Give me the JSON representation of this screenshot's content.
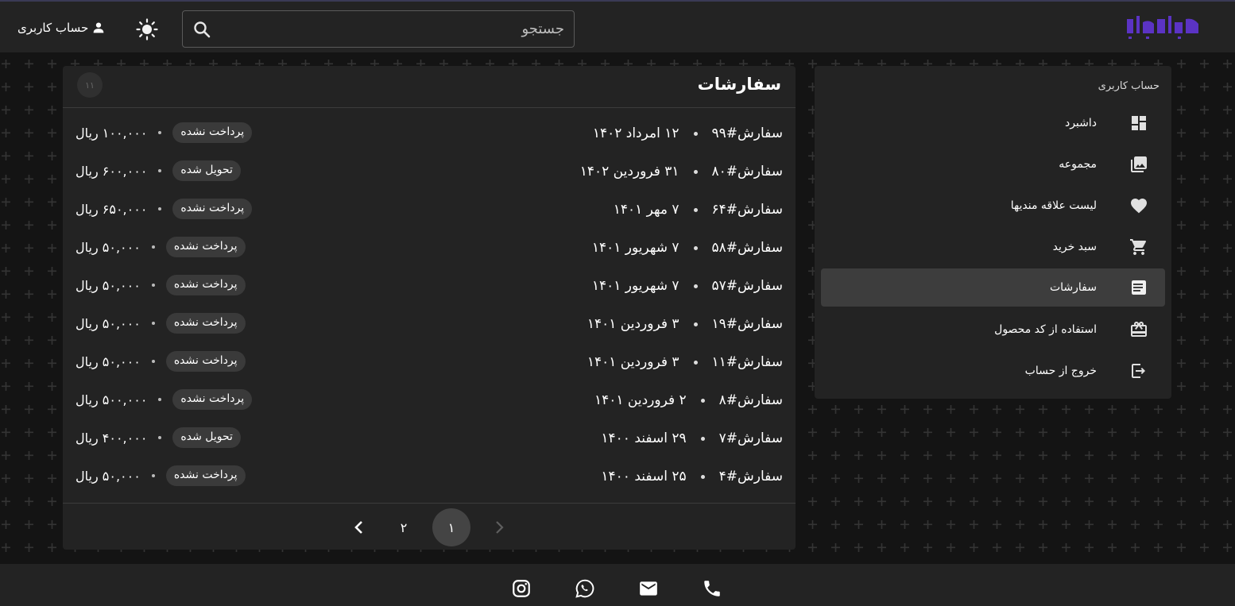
{
  "header": {
    "search_placeholder": "جستجو",
    "account_label": "حساب کاربری"
  },
  "sidebar": {
    "title": "حساب کاربری",
    "items": [
      {
        "label": "داشبرد",
        "icon": "dashboard-icon"
      },
      {
        "label": "مجموعه",
        "icon": "collection-icon"
      },
      {
        "label": "لیست علاقه مندیها",
        "icon": "heart-icon"
      },
      {
        "label": "سبد خرید",
        "icon": "cart-icon"
      },
      {
        "label": "سفارشات",
        "icon": "orders-list-icon",
        "active": true
      },
      {
        "label": "استفاده از کد محصول",
        "icon": "gift-icon"
      },
      {
        "label": "خروج از حساب",
        "icon": "logout-icon"
      }
    ]
  },
  "orders": {
    "title": "سفارشات",
    "count": "۱۱",
    "rows": [
      {
        "id": "سفارش#۹۹",
        "date": "۱۲ امرداد ۱۴۰۲",
        "status": "پرداخت نشده",
        "amount": "۱۰۰,۰۰۰ ریال"
      },
      {
        "id": "سفارش#۸۰",
        "date": "۳۱ فروردین ۱۴۰۲",
        "status": "تحویل شده",
        "amount": "۶۰۰,۰۰۰ ریال"
      },
      {
        "id": "سفارش#۶۴",
        "date": "۷ مهر ۱۴۰۱",
        "status": "پرداخت نشده",
        "amount": "۶۵۰,۰۰۰ ریال"
      },
      {
        "id": "سفارش#۵۸",
        "date": "۷ شهریور ۱۴۰۱",
        "status": "پرداخت نشده",
        "amount": "۵۰,۰۰۰ ریال"
      },
      {
        "id": "سفارش#۵۷",
        "date": "۷ شهریور ۱۴۰۱",
        "status": "پرداخت نشده",
        "amount": "۵۰,۰۰۰ ریال"
      },
      {
        "id": "سفارش#۱۹",
        "date": "۳ فروردین ۱۴۰۱",
        "status": "پرداخت نشده",
        "amount": "۵۰,۰۰۰ ریال"
      },
      {
        "id": "سفارش#۱۱",
        "date": "۳ فروردین ۱۴۰۱",
        "status": "پرداخت نشده",
        "amount": "۵۰,۰۰۰ ریال"
      },
      {
        "id": "سفارش#۸",
        "date": "۲ فروردین ۱۴۰۱",
        "status": "پرداخت نشده",
        "amount": "۵۰۰,۰۰۰ ریال"
      },
      {
        "id": "سفارش#۷",
        "date": "۲۹ اسفند ۱۴۰۰",
        "status": "تحویل شده",
        "amount": "۴۰۰,۰۰۰ ریال"
      },
      {
        "id": "سفارش#۴",
        "date": "۲۵ اسفند ۱۴۰۰",
        "status": "پرداخت نشده",
        "amount": "۵۰,۰۰۰ ریال"
      }
    ]
  },
  "pagination": {
    "pages": [
      "۱",
      "۲"
    ],
    "current": "۱"
  },
  "footer": {
    "icons": [
      "instagram-icon",
      "whatsapp-icon",
      "email-icon",
      "phone-icon"
    ]
  },
  "colors": {
    "background": "#141414",
    "surface": "#232323",
    "active_item": "#3d3d3d",
    "badge": "#3a3a3a",
    "logo": "#6c3cd6"
  }
}
